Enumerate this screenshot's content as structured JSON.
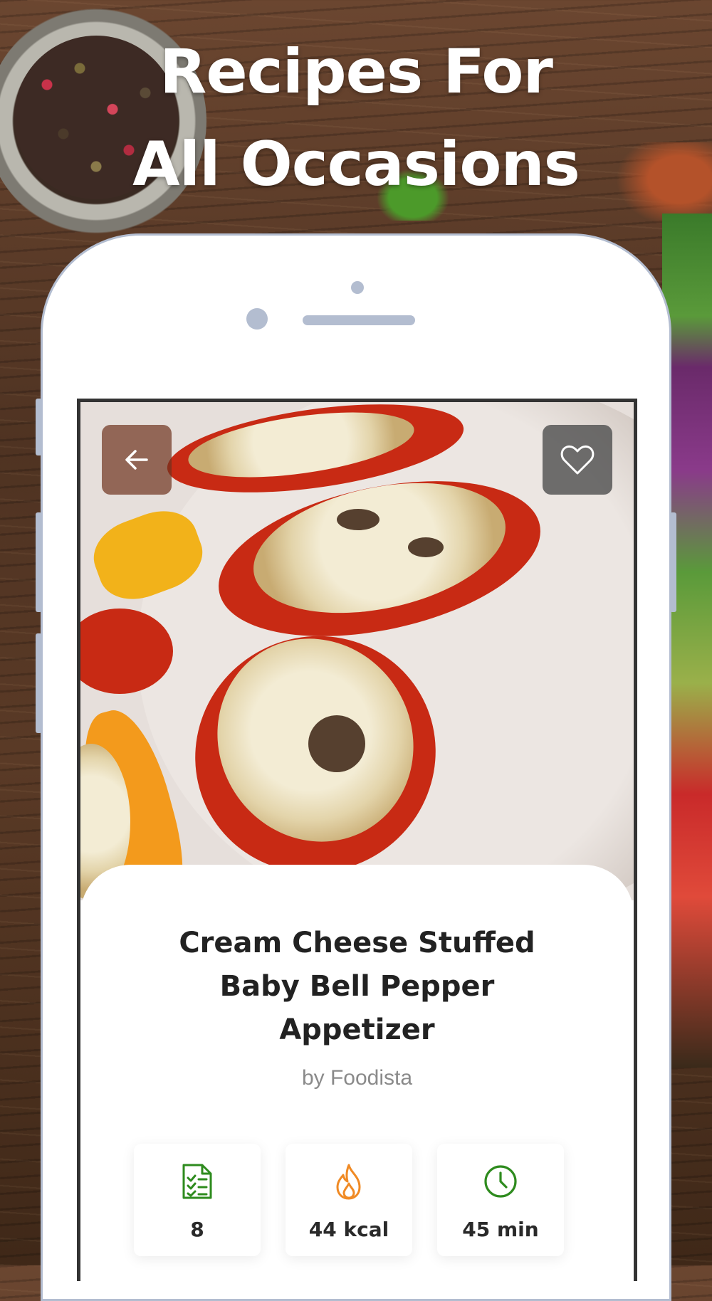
{
  "headline": {
    "line1": "Recipes For",
    "line2": "All Occasions"
  },
  "recipe": {
    "title_line1": "Cream Cheese Stuffed",
    "title_line2": "Baby Bell Pepper",
    "title_line3": "Appetizer",
    "author": "by Foodista"
  },
  "stats": [
    {
      "icon": "checklist-icon",
      "value": "8",
      "color": "#2e8b1e"
    },
    {
      "icon": "flame-icon",
      "value": "44 kcal",
      "color": "#f08a24"
    },
    {
      "icon": "clock-icon",
      "value": "45 min",
      "color": "#2e8b1e"
    }
  ],
  "colors": {
    "phone_frame": "#b3bdd0",
    "text_dark": "#222222",
    "author_gray": "#8a8a8a"
  }
}
